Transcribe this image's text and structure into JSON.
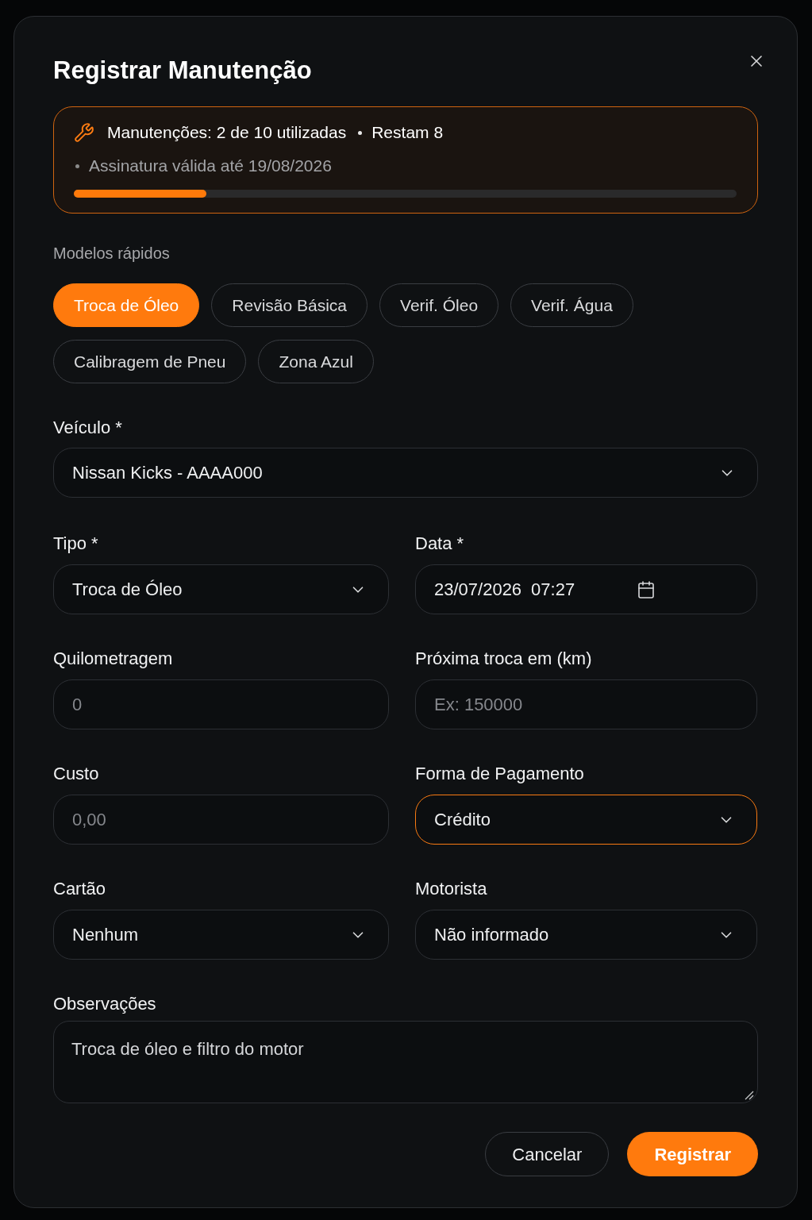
{
  "dialog": {
    "title": "Registrar Manutenção"
  },
  "quota": {
    "usage": "Manutenções: 2 de 10 utilizadas",
    "remaining": "Restam 8",
    "subscription": "Assinatura válida até 19/08/2026",
    "level": 0.2
  },
  "quick_templates": {
    "label": "Modelos rápidos",
    "items": [
      {
        "label": "Troca de Óleo",
        "selected": true
      },
      {
        "label": "Revisão Básica",
        "selected": false
      },
      {
        "label": "Verif. Óleo",
        "selected": false
      },
      {
        "label": "Verif. Água",
        "selected": false
      },
      {
        "label": "Calibragem de Pneu",
        "selected": false
      },
      {
        "label": "Zona Azul",
        "selected": false
      }
    ]
  },
  "vehicle": {
    "label": "Veículo *",
    "value": "Nissan Kicks - AAAA000",
    "focused": false
  },
  "fields": [
    {
      "kind": "select",
      "label": "Tipo *",
      "value": "Troca de Óleo",
      "focused": false
    },
    {
      "kind": "datetime",
      "label": "Data *",
      "date": "23/07/2026",
      "time": "07:27",
      "focused": false
    },
    {
      "kind": "input",
      "label": "Quilometragem",
      "placeholder": "0",
      "focused": false
    },
    {
      "kind": "input",
      "label": "Próxima troca em (km)",
      "placeholder": "Ex: 150000",
      "focused": false
    },
    {
      "kind": "input",
      "label": "Custo",
      "placeholder": "0,00",
      "focused": false
    },
    {
      "kind": "select",
      "label": "Forma de Pagamento",
      "value": "Crédito",
      "focused": true
    },
    {
      "kind": "select",
      "label": "Cartão",
      "value": "Nenhum",
      "focused": false
    },
    {
      "kind": "select",
      "label": "Motorista",
      "value": "Não informado",
      "focused": false
    }
  ],
  "notes": {
    "label": "Observações",
    "value": "Troca de óleo e filtro do motor"
  },
  "actions": [
    {
      "kind": "secondary",
      "label": "Cancelar"
    },
    {
      "kind": "primary",
      "label": "Registrar"
    }
  ]
}
